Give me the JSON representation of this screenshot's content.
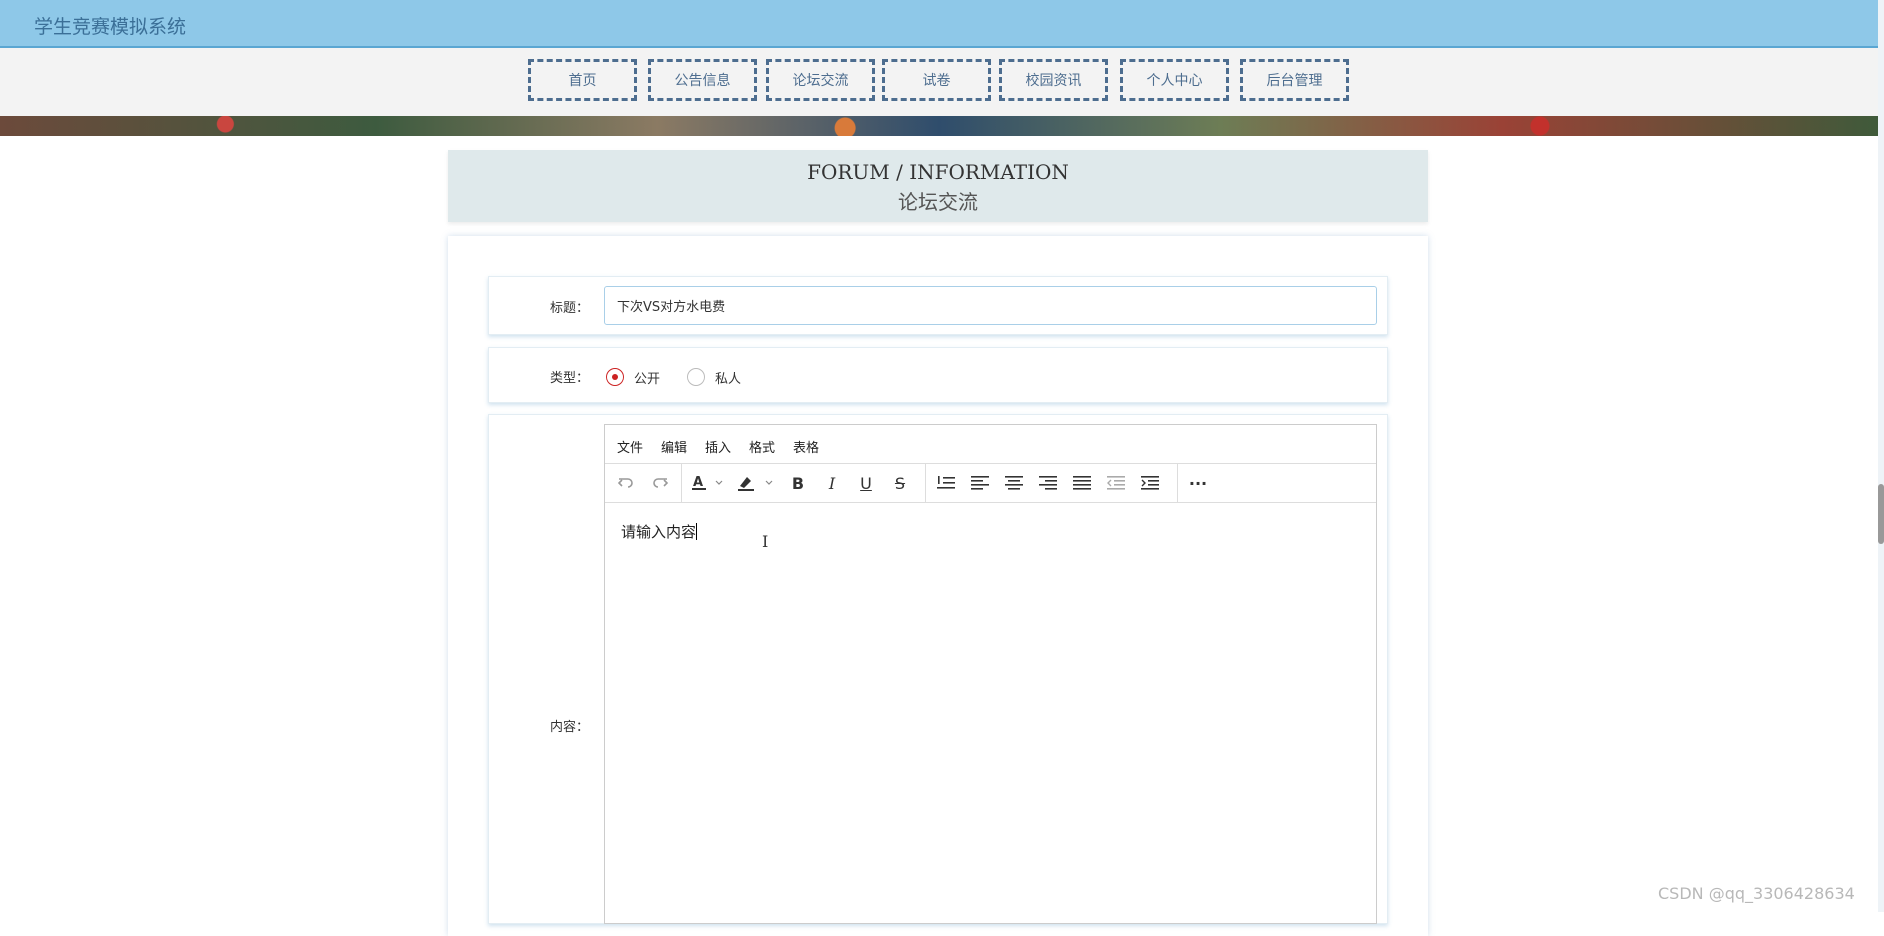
{
  "app": {
    "title": "学生竞赛模拟系统"
  },
  "nav": [
    {
      "label": "首页"
    },
    {
      "label": "公告信息"
    },
    {
      "label": "论坛交流"
    },
    {
      "label": "试卷"
    },
    {
      "label": "校园资讯"
    },
    {
      "label": "个人中心"
    },
    {
      "label": "后台管理"
    }
  ],
  "page": {
    "title_en": "FORUM / INFORMATION",
    "title_cn": "论坛交流"
  },
  "form": {
    "title_label": "标题：",
    "title_value": "下次VS对方水电费",
    "type_label": "类型：",
    "type_options": [
      {
        "label": "公开",
        "checked": true
      },
      {
        "label": "私人",
        "checked": false
      }
    ],
    "content_label": "内容："
  },
  "editor": {
    "menu": [
      "文件",
      "编辑",
      "插入",
      "格式",
      "表格"
    ],
    "toolbar_icons": [
      "undo-icon",
      "redo-icon",
      "font-color-icon",
      "highlight-icon",
      "bold-icon",
      "italic-icon",
      "underline-icon",
      "strikethrough-icon",
      "line-height-icon",
      "align-left-icon",
      "align-center-icon",
      "align-right-icon",
      "justify-icon",
      "outdent-icon",
      "indent-icon",
      "more-icon"
    ],
    "content": "请输入内容"
  },
  "watermark": "CSDN @qq_3306428634",
  "colors": {
    "header_bg": "#8ec8e8",
    "nav_border": "#4d6d8f",
    "radio_accent": "#cc2222"
  }
}
